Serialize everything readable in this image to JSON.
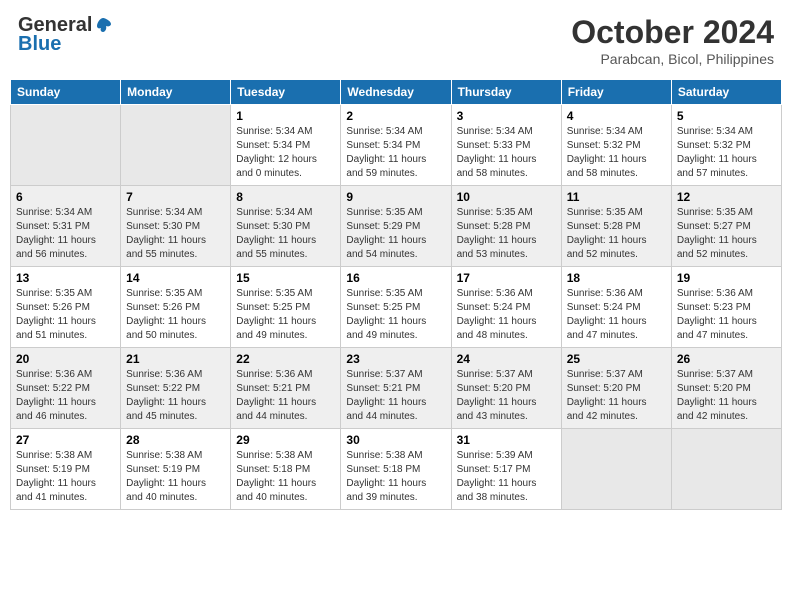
{
  "logo": {
    "general": "General",
    "blue": "Blue"
  },
  "title": "October 2024",
  "location": "Parabcan, Bicol, Philippines",
  "days_header": [
    "Sunday",
    "Monday",
    "Tuesday",
    "Wednesday",
    "Thursday",
    "Friday",
    "Saturday"
  ],
  "weeks": [
    [
      {
        "num": "",
        "sunrise": "",
        "sunset": "",
        "daylight": "",
        "empty": true
      },
      {
        "num": "",
        "sunrise": "",
        "sunset": "",
        "daylight": "",
        "empty": true
      },
      {
        "num": "1",
        "sunrise": "Sunrise: 5:34 AM",
        "sunset": "Sunset: 5:34 PM",
        "daylight": "Daylight: 12 hours and 0 minutes."
      },
      {
        "num": "2",
        "sunrise": "Sunrise: 5:34 AM",
        "sunset": "Sunset: 5:34 PM",
        "daylight": "Daylight: 11 hours and 59 minutes."
      },
      {
        "num": "3",
        "sunrise": "Sunrise: 5:34 AM",
        "sunset": "Sunset: 5:33 PM",
        "daylight": "Daylight: 11 hours and 58 minutes."
      },
      {
        "num": "4",
        "sunrise": "Sunrise: 5:34 AM",
        "sunset": "Sunset: 5:32 PM",
        "daylight": "Daylight: 11 hours and 58 minutes."
      },
      {
        "num": "5",
        "sunrise": "Sunrise: 5:34 AM",
        "sunset": "Sunset: 5:32 PM",
        "daylight": "Daylight: 11 hours and 57 minutes."
      }
    ],
    [
      {
        "num": "6",
        "sunrise": "Sunrise: 5:34 AM",
        "sunset": "Sunset: 5:31 PM",
        "daylight": "Daylight: 11 hours and 56 minutes."
      },
      {
        "num": "7",
        "sunrise": "Sunrise: 5:34 AM",
        "sunset": "Sunset: 5:30 PM",
        "daylight": "Daylight: 11 hours and 55 minutes."
      },
      {
        "num": "8",
        "sunrise": "Sunrise: 5:34 AM",
        "sunset": "Sunset: 5:30 PM",
        "daylight": "Daylight: 11 hours and 55 minutes."
      },
      {
        "num": "9",
        "sunrise": "Sunrise: 5:35 AM",
        "sunset": "Sunset: 5:29 PM",
        "daylight": "Daylight: 11 hours and 54 minutes."
      },
      {
        "num": "10",
        "sunrise": "Sunrise: 5:35 AM",
        "sunset": "Sunset: 5:28 PM",
        "daylight": "Daylight: 11 hours and 53 minutes."
      },
      {
        "num": "11",
        "sunrise": "Sunrise: 5:35 AM",
        "sunset": "Sunset: 5:28 PM",
        "daylight": "Daylight: 11 hours and 52 minutes."
      },
      {
        "num": "12",
        "sunrise": "Sunrise: 5:35 AM",
        "sunset": "Sunset: 5:27 PM",
        "daylight": "Daylight: 11 hours and 52 minutes."
      }
    ],
    [
      {
        "num": "13",
        "sunrise": "Sunrise: 5:35 AM",
        "sunset": "Sunset: 5:26 PM",
        "daylight": "Daylight: 11 hours and 51 minutes."
      },
      {
        "num": "14",
        "sunrise": "Sunrise: 5:35 AM",
        "sunset": "Sunset: 5:26 PM",
        "daylight": "Daylight: 11 hours and 50 minutes."
      },
      {
        "num": "15",
        "sunrise": "Sunrise: 5:35 AM",
        "sunset": "Sunset: 5:25 PM",
        "daylight": "Daylight: 11 hours and 49 minutes."
      },
      {
        "num": "16",
        "sunrise": "Sunrise: 5:35 AM",
        "sunset": "Sunset: 5:25 PM",
        "daylight": "Daylight: 11 hours and 49 minutes."
      },
      {
        "num": "17",
        "sunrise": "Sunrise: 5:36 AM",
        "sunset": "Sunset: 5:24 PM",
        "daylight": "Daylight: 11 hours and 48 minutes."
      },
      {
        "num": "18",
        "sunrise": "Sunrise: 5:36 AM",
        "sunset": "Sunset: 5:24 PM",
        "daylight": "Daylight: 11 hours and 47 minutes."
      },
      {
        "num": "19",
        "sunrise": "Sunrise: 5:36 AM",
        "sunset": "Sunset: 5:23 PM",
        "daylight": "Daylight: 11 hours and 47 minutes."
      }
    ],
    [
      {
        "num": "20",
        "sunrise": "Sunrise: 5:36 AM",
        "sunset": "Sunset: 5:22 PM",
        "daylight": "Daylight: 11 hours and 46 minutes."
      },
      {
        "num": "21",
        "sunrise": "Sunrise: 5:36 AM",
        "sunset": "Sunset: 5:22 PM",
        "daylight": "Daylight: 11 hours and 45 minutes."
      },
      {
        "num": "22",
        "sunrise": "Sunrise: 5:36 AM",
        "sunset": "Sunset: 5:21 PM",
        "daylight": "Daylight: 11 hours and 44 minutes."
      },
      {
        "num": "23",
        "sunrise": "Sunrise: 5:37 AM",
        "sunset": "Sunset: 5:21 PM",
        "daylight": "Daylight: 11 hours and 44 minutes."
      },
      {
        "num": "24",
        "sunrise": "Sunrise: 5:37 AM",
        "sunset": "Sunset: 5:20 PM",
        "daylight": "Daylight: 11 hours and 43 minutes."
      },
      {
        "num": "25",
        "sunrise": "Sunrise: 5:37 AM",
        "sunset": "Sunset: 5:20 PM",
        "daylight": "Daylight: 11 hours and 42 minutes."
      },
      {
        "num": "26",
        "sunrise": "Sunrise: 5:37 AM",
        "sunset": "Sunset: 5:20 PM",
        "daylight": "Daylight: 11 hours and 42 minutes."
      }
    ],
    [
      {
        "num": "27",
        "sunrise": "Sunrise: 5:38 AM",
        "sunset": "Sunset: 5:19 PM",
        "daylight": "Daylight: 11 hours and 41 minutes."
      },
      {
        "num": "28",
        "sunrise": "Sunrise: 5:38 AM",
        "sunset": "Sunset: 5:19 PM",
        "daylight": "Daylight: 11 hours and 40 minutes."
      },
      {
        "num": "29",
        "sunrise": "Sunrise: 5:38 AM",
        "sunset": "Sunset: 5:18 PM",
        "daylight": "Daylight: 11 hours and 40 minutes."
      },
      {
        "num": "30",
        "sunrise": "Sunrise: 5:38 AM",
        "sunset": "Sunset: 5:18 PM",
        "daylight": "Daylight: 11 hours and 39 minutes."
      },
      {
        "num": "31",
        "sunrise": "Sunrise: 5:39 AM",
        "sunset": "Sunset: 5:17 PM",
        "daylight": "Daylight: 11 hours and 38 minutes."
      },
      {
        "num": "",
        "sunrise": "",
        "sunset": "",
        "daylight": "",
        "empty": true
      },
      {
        "num": "",
        "sunrise": "",
        "sunset": "",
        "daylight": "",
        "empty": true
      }
    ]
  ]
}
